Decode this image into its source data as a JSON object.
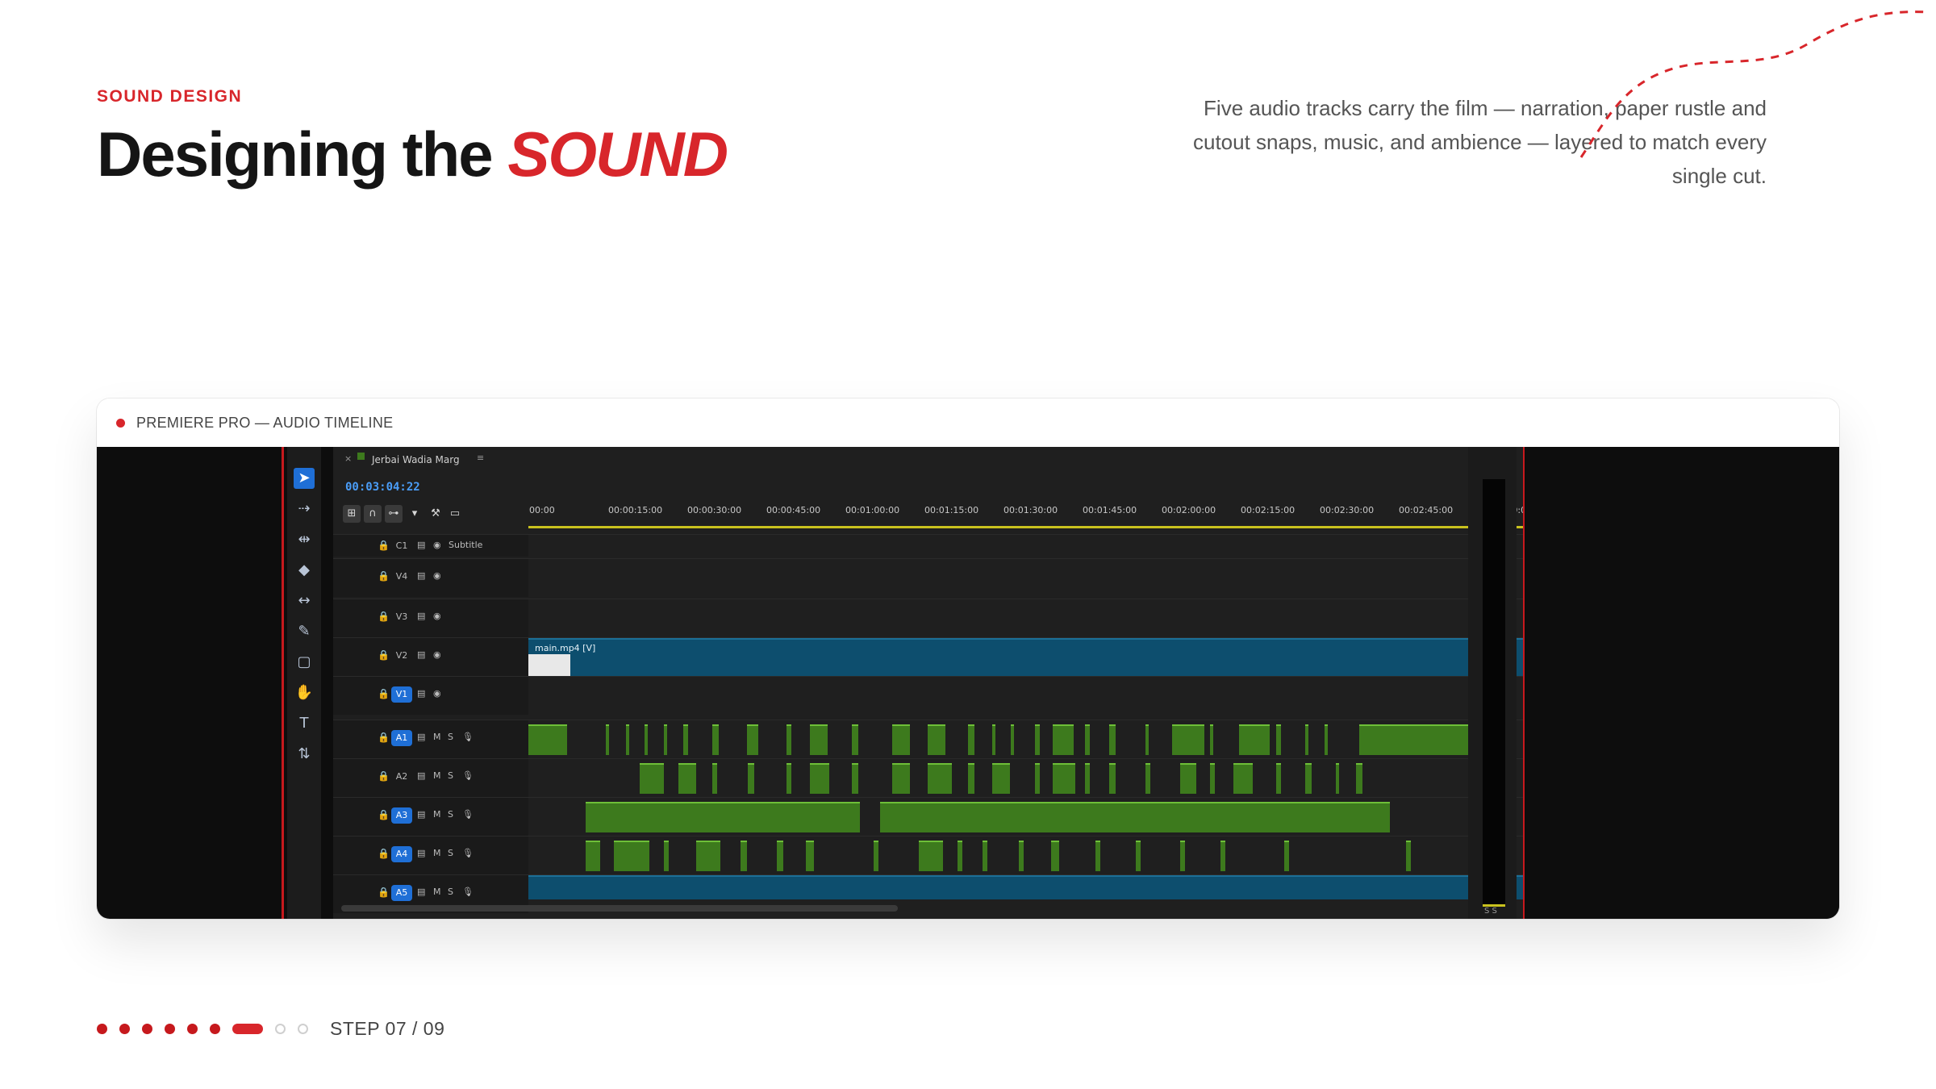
{
  "header": {
    "eyebrow": "SOUND DESIGN",
    "title_main": "Designing the",
    "title_accent": "SOUND",
    "description": "Five audio tracks carry the film — narration, paper rustle and cutout snaps, music, and ambience — layered to match every single cut."
  },
  "colors": {
    "accent": "#d8262b",
    "timeline_bg": "#1f1f1f",
    "video_clip": "#0d4e6e",
    "audio_clip": "#3d7a1d",
    "playhead": "#3c8ee8",
    "ruler": "#c9c21e"
  },
  "window": {
    "title": "PREMIERE PRO — AUDIO TIMELINE"
  },
  "premiere": {
    "sequence_name": "Jerbai Wadia Marg",
    "timecode": "00:03:04:22",
    "ruler_labels": [
      "00:00",
      "00:00:15:00",
      "00:00:30:00",
      "00:00:45:00",
      "00:01:00:00",
      "00:01:15:00",
      "00:01:30:00",
      "00:01:45:00",
      "00:02:00:00",
      "00:02:15:00",
      "00:02:30:00",
      "00:02:45:00",
      "00:03:00:00",
      "00:03:15:0"
    ],
    "tracks": [
      {
        "name": "C1",
        "label": "Subtitle",
        "kind": "caption"
      },
      {
        "name": "V4",
        "kind": "video"
      },
      {
        "name": "V3",
        "kind": "video"
      },
      {
        "name": "V2",
        "kind": "video",
        "clip": "main.mp4 [V]"
      },
      {
        "name": "V1",
        "kind": "video",
        "active": true
      },
      {
        "name": "A1",
        "kind": "audio",
        "active": true
      },
      {
        "name": "A2",
        "kind": "audio"
      },
      {
        "name": "A3",
        "kind": "audio",
        "active": true
      },
      {
        "name": "A4",
        "kind": "audio",
        "active": true
      },
      {
        "name": "A5",
        "kind": "audio",
        "active": true
      }
    ],
    "audio_flags": {
      "mute": "M",
      "solo": "S"
    },
    "meter_labels": "S S"
  },
  "progress": {
    "total": 9,
    "current": 7,
    "step_label": "STEP 07 / 09"
  }
}
